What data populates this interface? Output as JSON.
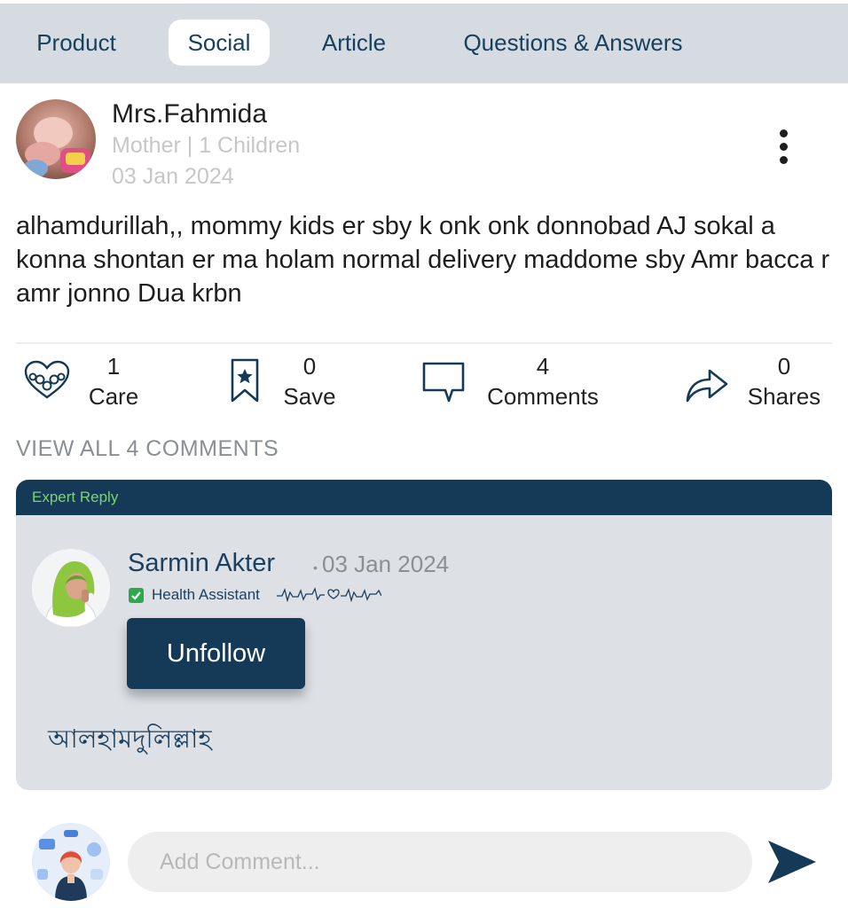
{
  "tabs": [
    {
      "label": "Product",
      "active": false
    },
    {
      "label": "Social",
      "active": true
    },
    {
      "label": "Article",
      "active": false
    },
    {
      "label": "Questions & Answers",
      "active": false
    }
  ],
  "post": {
    "author_name": "Mrs.Fahmida",
    "author_meta": "Mother | 1 Children",
    "date": "03 Jan 2024",
    "body": "alhamdurillah,, mommy kids er sby k onk onk donnobad AJ sokal a konna shontan er ma holam normal delivery maddome sby Amr bacca r amr jonno Dua krbn"
  },
  "actions": {
    "care": {
      "count": "1",
      "label": "Care",
      "icon": "heart-care-icon"
    },
    "save": {
      "count": "0",
      "label": "Save",
      "icon": "bookmark-star-icon"
    },
    "comments": {
      "count": "4",
      "label": "Comments",
      "icon": "comment-bubble-icon"
    },
    "shares": {
      "count": "0",
      "label": "Shares",
      "icon": "share-arrow-icon"
    }
  },
  "view_all_comments": "VIEW ALL 4 COMMENTS",
  "expert_reply": {
    "header": "Expert Reply",
    "name": "Sarmin Akter",
    "date": "03 Jan 2024",
    "role": "Health Assistant",
    "unfollow_label": "Unfollow",
    "text": "আলহামদুলিল্লাহ"
  },
  "comment_input": {
    "placeholder": "Add Comment..."
  },
  "colors": {
    "navy": "#143a57",
    "tab_bar": "#d5dbe0",
    "card_bg": "#dde1e6",
    "expert_label": "#7fd36f",
    "verified_green": "#2da84a"
  }
}
